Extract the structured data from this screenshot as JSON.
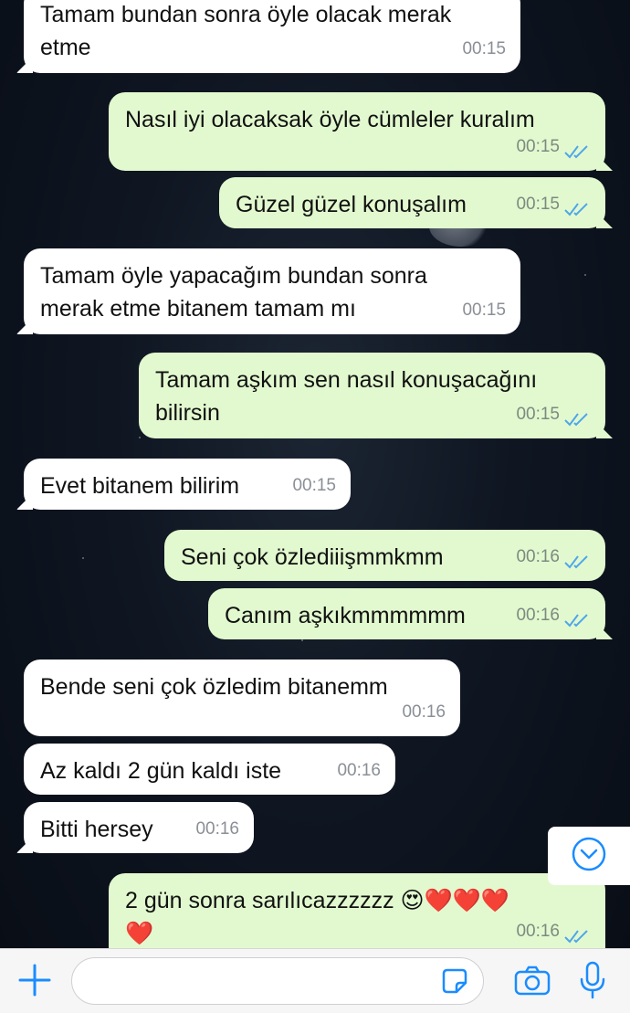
{
  "colors": {
    "incoming": "#ffffff",
    "outgoing": "#e2f9cf",
    "read_ticks": "#4fa6ea",
    "accent": "#1a8cff"
  },
  "messages": [
    {
      "dir": "in",
      "text_lines": [
        "Tamam bundan sonra öyle olacak merak",
        "etme"
      ],
      "time": "00:15"
    },
    {
      "dir": "out",
      "text_lines": [
        "Nasıl iyi olacaksak öyle cümleler kuralım"
      ],
      "time": "00:15",
      "status": "read"
    },
    {
      "dir": "out",
      "text_lines": [
        "Güzel güzel konuşalım"
      ],
      "time": "00:15",
      "status": "read"
    },
    {
      "dir": "in",
      "text_lines": [
        "Tamam öyle yapacağım bundan sonra",
        "merak etme bitanem tamam mı"
      ],
      "time": "00:15"
    },
    {
      "dir": "out",
      "text_lines": [
        "Tamam aşkım sen nasıl konuşacağını",
        "bilirsin"
      ],
      "time": "00:15",
      "status": "read"
    },
    {
      "dir": "in",
      "text_lines": [
        "Evet bitanem bilirim"
      ],
      "time": "00:15"
    },
    {
      "dir": "out",
      "text_lines": [
        "Seni çok özlediiişmmkmm"
      ],
      "time": "00:16",
      "status": "read"
    },
    {
      "dir": "out",
      "text_lines": [
        "Canım aşkıkmmmmmm"
      ],
      "time": "00:16",
      "status": "read"
    },
    {
      "dir": "in",
      "text_lines": [
        "Bende seni çok özledim bitanemm"
      ],
      "time": "00:16"
    },
    {
      "dir": "in",
      "text_lines": [
        "Az kaldı 2 gün kaldı iste"
      ],
      "time": "00:16"
    },
    {
      "dir": "in",
      "text_lines": [
        "Bitti hersey"
      ],
      "time": "00:16"
    },
    {
      "dir": "out",
      "text_lines": [
        "2 gün sonra sarılıcazzzzzz 😍❤️❤️❤️",
        "❤️"
      ],
      "time": "00:16",
      "status": "read"
    }
  ],
  "composer": {
    "placeholder": "",
    "icons": [
      "plus-icon",
      "sticker-icon",
      "camera-icon",
      "microphone-icon"
    ]
  },
  "scroll_button_icon": "chevron-down-circle-icon"
}
